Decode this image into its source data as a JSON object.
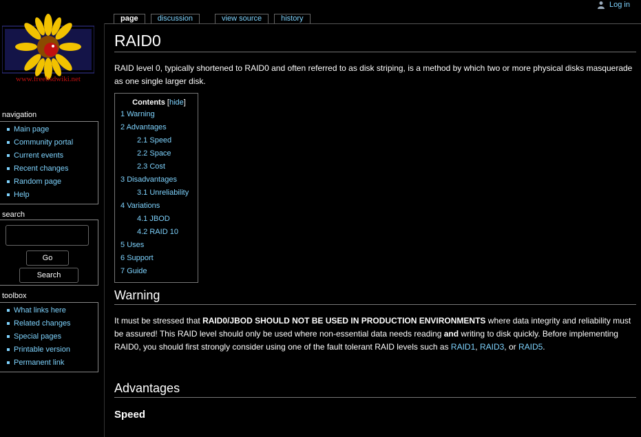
{
  "header": {
    "login": "Log in",
    "tabs": [
      {
        "label": "page"
      },
      {
        "label": "discussion"
      },
      {
        "label": "view source"
      },
      {
        "label": "history"
      }
    ]
  },
  "logo": {
    "text": "www.freebsdwiki.net"
  },
  "sidebar": {
    "navigation": {
      "title": "navigation",
      "items": [
        "Main page",
        "Community portal",
        "Current events",
        "Recent changes",
        "Random page",
        "Help"
      ]
    },
    "search": {
      "title": "search",
      "go_label": "Go",
      "search_label": "Search"
    },
    "toolbox": {
      "title": "toolbox",
      "items": [
        "What links here",
        "Related changes",
        "Special pages",
        "Printable version",
        "Permanent link"
      ]
    }
  },
  "article": {
    "title": "RAID0",
    "intro": "RAID level 0, typically shortened to RAID0 and often referred to as disk striping, is a method by which two or more physical disks masquerade as one single larger disk.",
    "toc": {
      "title": "Contents",
      "hide": "hide",
      "entries": [
        {
          "num": "1",
          "text": "Warning"
        },
        {
          "num": "2",
          "text": "Advantages"
        },
        {
          "num": "2.1",
          "text": "Speed"
        },
        {
          "num": "2.2",
          "text": "Space"
        },
        {
          "num": "2.3",
          "text": "Cost"
        },
        {
          "num": "3",
          "text": "Disadvantages"
        },
        {
          "num": "3.1",
          "text": "Unreliability"
        },
        {
          "num": "4",
          "text": "Variations"
        },
        {
          "num": "4.1",
          "text": "JBOD"
        },
        {
          "num": "4.2",
          "text": "RAID 10"
        },
        {
          "num": "5",
          "text": "Uses"
        },
        {
          "num": "6",
          "text": "Support"
        },
        {
          "num": "7",
          "text": "Guide"
        }
      ]
    },
    "warning": {
      "heading": "Warning",
      "p1": "It must be stressed that ",
      "bold1": "RAID0/JBOD SHOULD NOT BE USED IN PRODUCTION ENVIRONMENTS",
      "p2": " where data integrity and reliability must be assured! This RAID level should only be used where non-essential data needs reading ",
      "bold2": "and",
      "p3": " writing to disk quickly. Before implementing RAID0, you should first strongly consider using one of the fault tolerant RAID levels such as ",
      "link1": "RAID1",
      "sep1": ", ",
      "link2": "RAID3",
      "sep2": ", or ",
      "link3": "RAID5",
      "end": "."
    },
    "advantages": {
      "heading": "Advantages"
    },
    "speed": {
      "heading": "Speed"
    }
  },
  "colors": {
    "background": "#000000",
    "link": "#7fd4ff",
    "text": "#ffffff"
  }
}
